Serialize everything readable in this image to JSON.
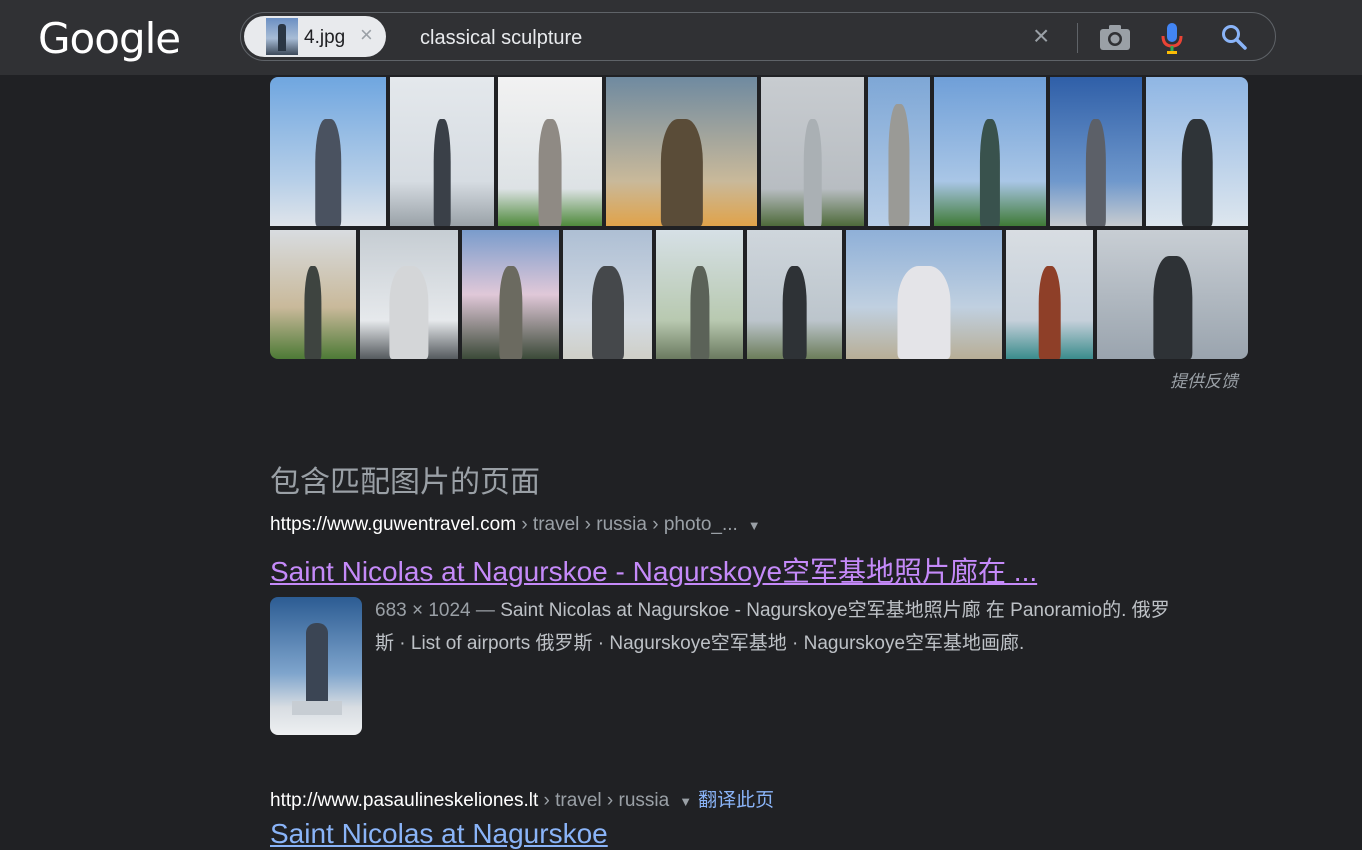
{
  "header": {
    "logo": "Google",
    "image_chip_label": "4.jpg",
    "chip_close": "×",
    "query": "classical sculpture",
    "clear_glyph": "×"
  },
  "icons": [
    "camera-icon",
    "mic-icon",
    "search-icon",
    "close-icon"
  ],
  "colors": {
    "background": "#202124",
    "header": "#303134",
    "visited_link": "#c58af9",
    "link": "#8ab4f8",
    "muted": "#9aa0a6"
  },
  "image_grid": {
    "feedback_label": "提供反馈"
  },
  "pages_section": {
    "title": "包含匹配图片的页面"
  },
  "results": [
    {
      "cite_host": "https://www.guwentravel.com",
      "cite_path": " › travel › russia › photo_...",
      "title": "Saint Nicolas at Nagurskoe - Nagurskoye空军基地照片廊在 ...",
      "meta": "683 × 1024 — ",
      "snippet": "Saint Nicolas at Nagurskoe - Nagurskoye空军基地照片廊 在 Panoramio的. 俄罗斯 · List of airports 俄罗斯 · Nagurskoye空军基地 · Nagurskoye空军基地画廊."
    },
    {
      "cite_host": "http://www.pasaulineskeliones.lt",
      "cite_path": " › travel › russia",
      "translate": "翻译此页",
      "title": "Saint Nicolas at Nagurskoe"
    }
  ]
}
